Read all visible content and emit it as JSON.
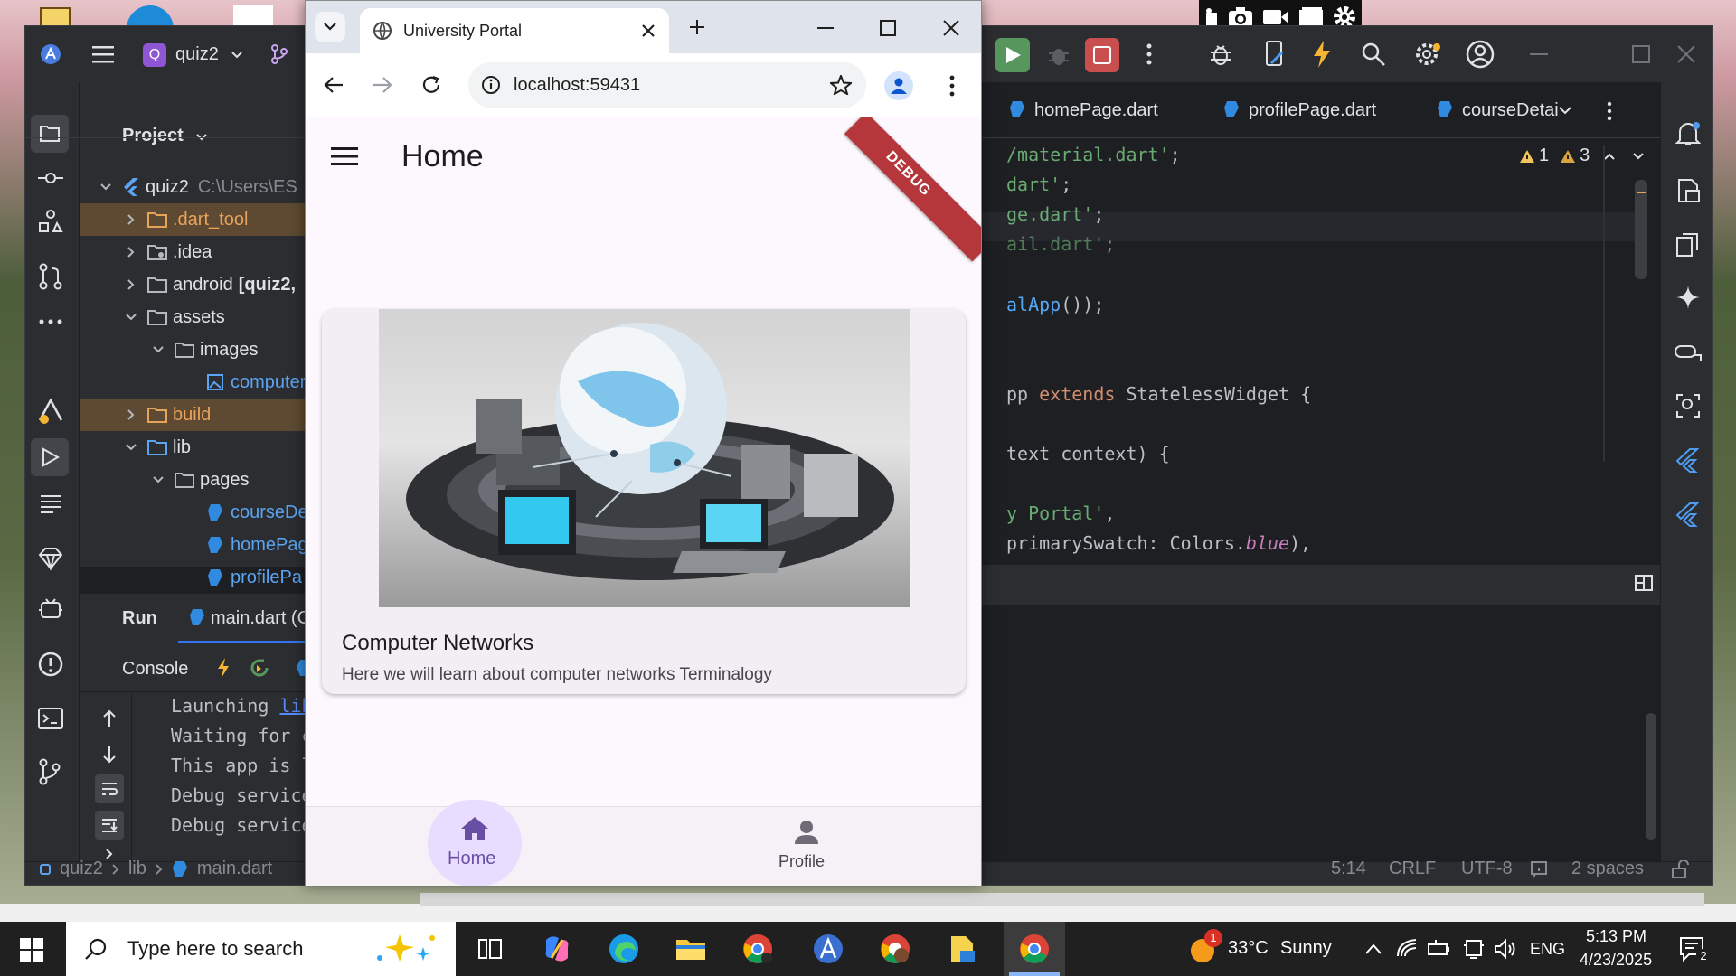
{
  "browser": {
    "tab_title": "University Portal",
    "url": "localhost:59431"
  },
  "app": {
    "title": "Home",
    "debug_banner": "DEBUG",
    "card": {
      "title": "Computer Networks",
      "subtitle": "Here we will learn about computer networks Terminalogy"
    },
    "nav": [
      {
        "label": "Home",
        "icon": "home-icon",
        "selected": true
      },
      {
        "label": "Profile",
        "icon": "person-icon",
        "selected": false
      }
    ],
    "colors": {
      "accent": "#6750a4",
      "background": "#fdf7fe",
      "card": "#f3eef4"
    }
  },
  "ide": {
    "project_initial": "Q",
    "project_name": "quiz2",
    "panel_title": "Project",
    "tree": [
      {
        "label": "quiz2",
        "extra": "C:\\Users\\ES"
      },
      {
        "label": ".dart_tool"
      },
      {
        "label": ".idea"
      },
      {
        "label": "android",
        "extra": "[quiz2,"
      },
      {
        "label": "assets"
      },
      {
        "label": "images"
      },
      {
        "label": "computer"
      },
      {
        "label": "build"
      },
      {
        "label": "lib"
      },
      {
        "label": "pages"
      },
      {
        "label": "courseDe"
      },
      {
        "label": "homePag"
      },
      {
        "label": "profilePa"
      }
    ],
    "editor_tabs": [
      "homePage.dart",
      "profilePage.dart",
      "courseDetai"
    ],
    "warnings": {
      "weak": "1",
      "strong": "3"
    },
    "code": [
      {
        "line": 1,
        "parts": [
          {
            "t": "/material.dart'",
            "c": "k-green"
          },
          {
            "t": ";",
            "c": "k-plain"
          }
        ]
      },
      {
        "line": 2,
        "parts": [
          {
            "t": "dart'",
            "c": "k-green"
          },
          {
            "t": ";",
            "c": "k-plain"
          }
        ]
      },
      {
        "line": 3,
        "parts": [
          {
            "t": "ge.dart'",
            "c": "k-green"
          },
          {
            "t": ";",
            "c": "k-plain"
          }
        ]
      },
      {
        "line": 4,
        "parts": [
          {
            "t": "ail.dart'",
            "c": "k-green"
          },
          {
            "t": ";",
            "c": "k-plain"
          }
        ]
      },
      {
        "line": 6,
        "parts": [
          {
            "t": "alApp",
            "c": "k-blue"
          },
          {
            "t": "());",
            "c": "k-plain"
          }
        ]
      },
      {
        "line": 9,
        "parts": [
          {
            "t": "pp ",
            "c": "k-plain"
          },
          {
            "t": "extends ",
            "c": "k-orange"
          },
          {
            "t": "StatelessWidget {",
            "c": "k-plain"
          }
        ]
      },
      {
        "line": 11,
        "parts": [
          {
            "t": "text context) {",
            "c": "k-plain"
          }
        ]
      },
      {
        "line": 13,
        "parts": [
          {
            "t": "y Portal'",
            "c": "k-green"
          },
          {
            "t": ",",
            "c": "k-plain"
          }
        ]
      },
      {
        "line": 14,
        "parts": [
          {
            "t": "primarySwatch: Colors.",
            "c": "k-plain"
          },
          {
            "t": "blue",
            "c": "k-purple"
          },
          {
            "t": "),",
            "c": "k-plain"
          }
        ]
      }
    ],
    "run_tab": "Run",
    "run_config": "main.dart (Ch",
    "console_label": "Console",
    "console_lines": [
      {
        "text": "Launching ",
        "link": "lib\\m"
      },
      {
        "text": "Waiting for con"
      },
      {
        "text": "This app is lin"
      },
      {
        "text": "Debug service l"
      },
      {
        "text": "Debug service l"
      }
    ],
    "breadcrumb": [
      "quiz2",
      "lib",
      "main.dart"
    ],
    "status": {
      "position": "5:14",
      "line_ending": "CRLF",
      "encoding": "UTF-8",
      "indent": "2 spaces"
    }
  },
  "taskbar": {
    "search_placeholder": "Type here to search",
    "weather": {
      "temp": "33°C",
      "condition": "Sunny",
      "badge": "1"
    },
    "language": "ENG",
    "time": "5:13 PM",
    "date": "4/23/2025",
    "notification_count": "2"
  }
}
